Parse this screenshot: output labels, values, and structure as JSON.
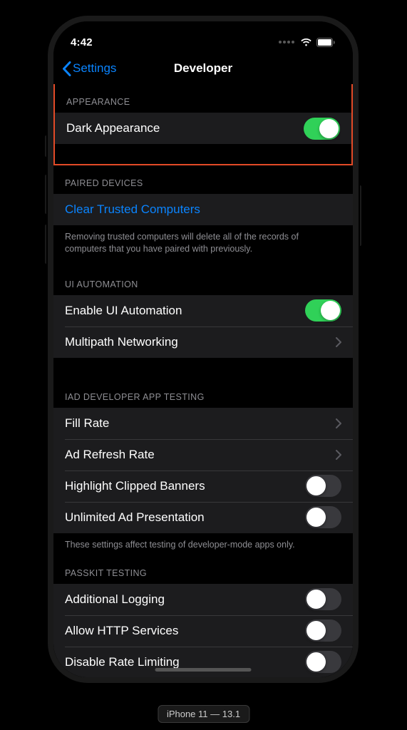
{
  "status": {
    "time": "4:42"
  },
  "nav": {
    "back_label": "Settings",
    "title": "Developer"
  },
  "sections": {
    "appearance": {
      "header": "APPEARANCE",
      "dark_appearance_label": "Dark Appearance",
      "dark_appearance_on": true
    },
    "paired_devices": {
      "header": "PAIRED DEVICES",
      "clear_label": "Clear Trusted Computers",
      "footer": "Removing trusted computers will delete all of the records of computers that you have paired with previously."
    },
    "ui_automation": {
      "header": "UI AUTOMATION",
      "enable_label": "Enable UI Automation",
      "enable_on": true,
      "multipath_label": "Multipath Networking"
    },
    "iad": {
      "header": "IAD DEVELOPER APP TESTING",
      "fill_rate_label": "Fill Rate",
      "ad_refresh_label": "Ad Refresh Rate",
      "highlight_label": "Highlight Clipped Banners",
      "highlight_on": false,
      "unlimited_label": "Unlimited Ad Presentation",
      "unlimited_on": false,
      "footer": "These settings affect testing of developer-mode apps only."
    },
    "passkit": {
      "header": "PASSKIT TESTING",
      "additional_logging_label": "Additional Logging",
      "additional_logging_on": false,
      "allow_http_label": "Allow HTTP Services",
      "allow_http_on": false,
      "disable_rate_label": "Disable Rate Limiting",
      "disable_rate_on": false
    }
  },
  "device_label": "iPhone 11 — 13.1"
}
